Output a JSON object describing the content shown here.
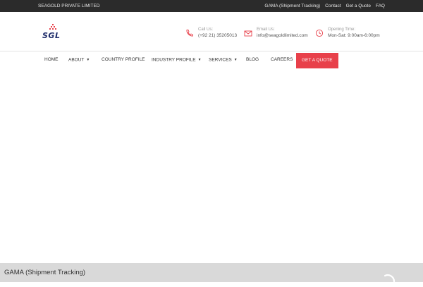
{
  "topbar": {
    "brand": "SEAGOLD PRIVATE LIMITED",
    "links": [
      "GAMA (Shipment Tracking)",
      "Contact",
      "Get a Quote",
      "FAQ"
    ]
  },
  "header": {
    "logo_text": "SGL",
    "call": {
      "label": "Call Us:",
      "value": "(+92 21) 35205013"
    },
    "email": {
      "label": "Email Us:",
      "value": "info@seagoldlimited.com"
    },
    "hours": {
      "label": "Opening Time:",
      "value": "Mon-Sat: 9:00am-6:00pm"
    }
  },
  "nav": {
    "items": [
      "HOME",
      "ABOUT",
      "COUNTRY PROFILE",
      "INDUSTRY PROFILE",
      "SERVICES",
      "BLOG",
      "CAREERS"
    ],
    "quote_label": "GET A QUOTE"
  },
  "colors": {
    "accent": "#e8404a",
    "navy": "#1f2d6b",
    "topbar": "#2b2b2b"
  },
  "footer": {
    "title": "GAMA (Shipment Tracking)"
  }
}
